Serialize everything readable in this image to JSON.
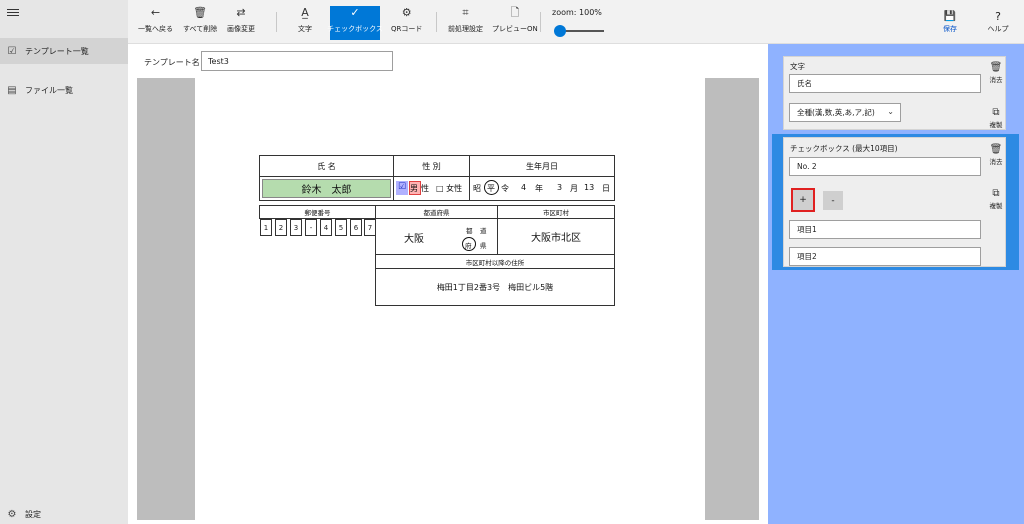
{
  "nav": {
    "items": [
      {
        "label": "テンプレート一覧",
        "icon": "template-list-icon"
      },
      {
        "label": "ファイル一覧",
        "icon": "file-list-icon"
      }
    ],
    "settings_label": "設定"
  },
  "toolbar": {
    "back_label": "一覧へ戻る",
    "delete_all_label": "すべて削除",
    "change_image_label": "画像変更",
    "text_label": "文字",
    "checkbox_label": "チェックボックス",
    "qr_label": "QRコード",
    "preprocess_label": "前処理設定",
    "preview_label": "プレビューON",
    "zoom_label": "zoom:  100%",
    "zoom_percent": 100,
    "save_label": "保存",
    "help_label": "ヘルプ",
    "accent_color": "#0078d7"
  },
  "editor": {
    "template_name_label": "テンプレート名：",
    "template_name_value": "Test3"
  },
  "form": {
    "name_header": "氏 名",
    "gender_header": "性 別",
    "birth_header": "生年月日",
    "name_value": "鈴木　太郎",
    "male": "男",
    "male_suffix": "性",
    "female": "□ 女性",
    "era_showa": "昭",
    "era_heisei": "平",
    "era_reiwa": "令",
    "birth_year": "4",
    "year_unit": "年",
    "birth_month": "3",
    "month_unit": "月",
    "birth_day": "13",
    "day_unit": "日",
    "postal_header": "郵便番号",
    "prefecture_header": "都道府県",
    "city_header": "市区町村",
    "postal_digits": [
      "1",
      "2",
      "3",
      "-",
      "4",
      "5",
      "6",
      "7"
    ],
    "prefecture_value": "大阪",
    "suffix_to": "都",
    "suffix_do": "道",
    "suffix_fu": "府",
    "suffix_ken": "県",
    "city_value": "大阪市北区",
    "address_header": "市区町村以降の住所",
    "address_value": "梅田1丁目2番3号　梅田ビル5階"
  },
  "panel": {
    "text_card": {
      "title": "文字",
      "field_value": "氏名",
      "select_value": "全種(漢,数,英,あ,ア,記)",
      "delete_label": "消去",
      "copy_label": "複製"
    },
    "checkbox_card": {
      "title": "チェックボックス (最大10項目)",
      "field_value": "No. 2",
      "plus_label": "+",
      "minus_label": "-",
      "items": [
        "項目1",
        "項目2"
      ],
      "delete_label": "消去",
      "copy_label": "複製"
    }
  }
}
